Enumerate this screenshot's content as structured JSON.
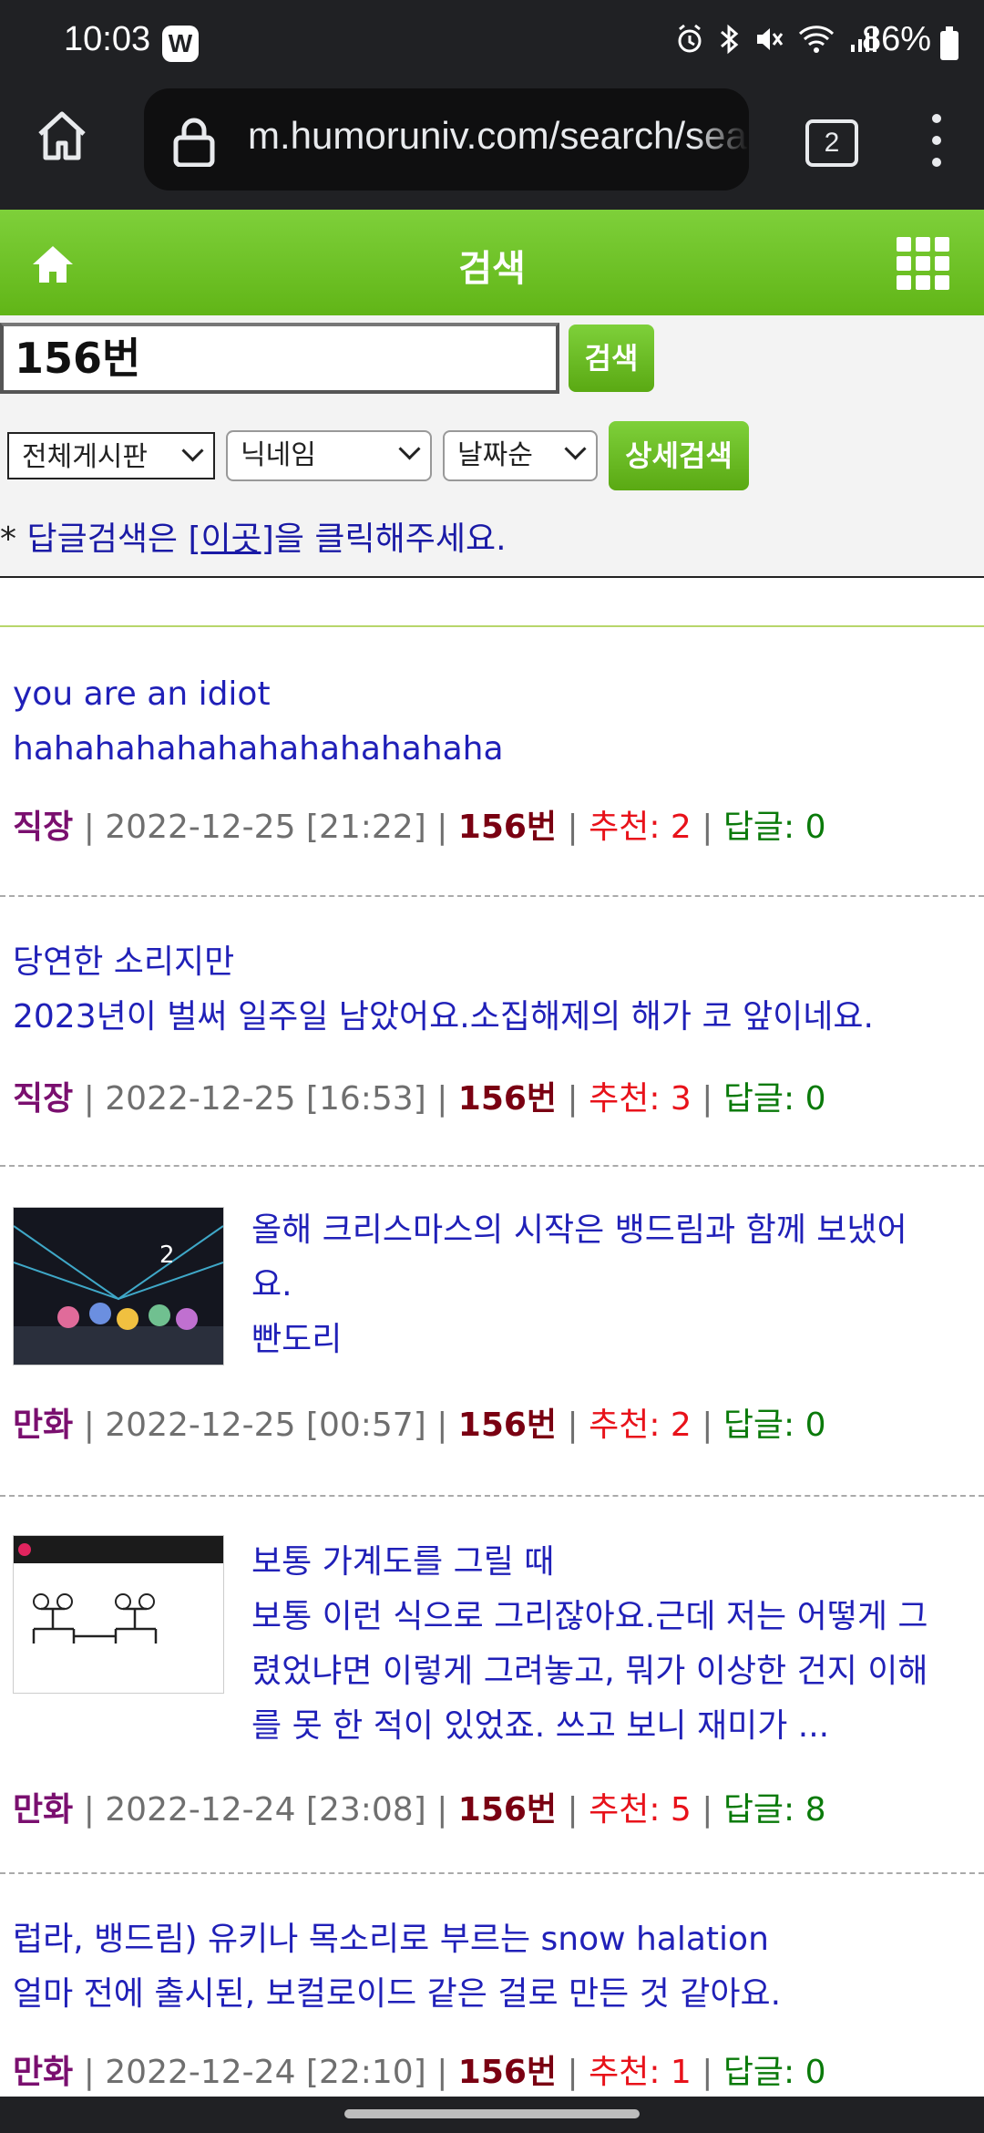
{
  "status_bar": {
    "time": "10:03",
    "badge": "W",
    "battery": "86%",
    "icons": [
      "alarm-icon",
      "bluetooth-icon",
      "mute-icon",
      "wifi-icon",
      "signal-icon"
    ]
  },
  "browser": {
    "url": "m.humoruniv.com/search/sea",
    "tab_count": "2"
  },
  "header": {
    "title": "검색"
  },
  "search": {
    "query": "156번",
    "button": "검색",
    "board_select": "전체게시판",
    "field_select": "닉네임",
    "sort_select": "날짜순",
    "detail_button": "상세검색",
    "reply_note_prefix": "* ",
    "reply_note_a": "답글검색은 ",
    "reply_note_link": "[이곳]",
    "reply_note_b": "을 클릭해주세요."
  },
  "results": [
    {
      "lines": [
        "you are an idiot",
        "hahahahahahahahahahahaha"
      ],
      "category": "직장",
      "date": "2022-12-25 [21:22]",
      "author": "156번",
      "recommend": "추천: 2",
      "replies": "답글: 0"
    },
    {
      "lines": [
        "당연한 소리지만",
        "2023년이 벌써 일주일 남았어요.소집해제의 해가 코 앞이네요."
      ],
      "category": "직장",
      "date": "2022-12-25 [16:53]",
      "author": "156번",
      "recommend": "추천: 3",
      "replies": "답글: 0"
    },
    {
      "lines": [
        "올해 크리스마스의 시작은 뱅드림과 함께 보냈어",
        "요.",
        "빤도리"
      ],
      "category": "만화",
      "date": "2022-12-25 [00:57]",
      "author": "156번",
      "recommend": "추천: 2",
      "replies": "답글: 0"
    },
    {
      "lines": [
        "보통 가계도를 그릴 때",
        "보통 이런 식으로 그리잖아요.근데 저는 어떻게 그",
        "렸었냐면 이렇게 그려놓고, 뭐가 이상한 건지 이해",
        "를 못 한 적이 있었죠. 쓰고 보니 재미가 ..."
      ],
      "category": "만화",
      "date": "2022-12-24 [23:08]",
      "author": "156번",
      "recommend": "추천: 5",
      "replies": "답글: 8"
    },
    {
      "lines": [
        "럽라, 뱅드림) 유키나 목소리로 부르는 snow halation",
        "얼마 전에 출시된, 보컬로이드 같은 걸로 만든 것 같아요."
      ],
      "category": "만화",
      "date": "2022-12-24 [22:10]",
      "author": "156번",
      "recommend": "추천: 1",
      "replies": "답글: 0"
    }
  ],
  "meta_separator": " | "
}
